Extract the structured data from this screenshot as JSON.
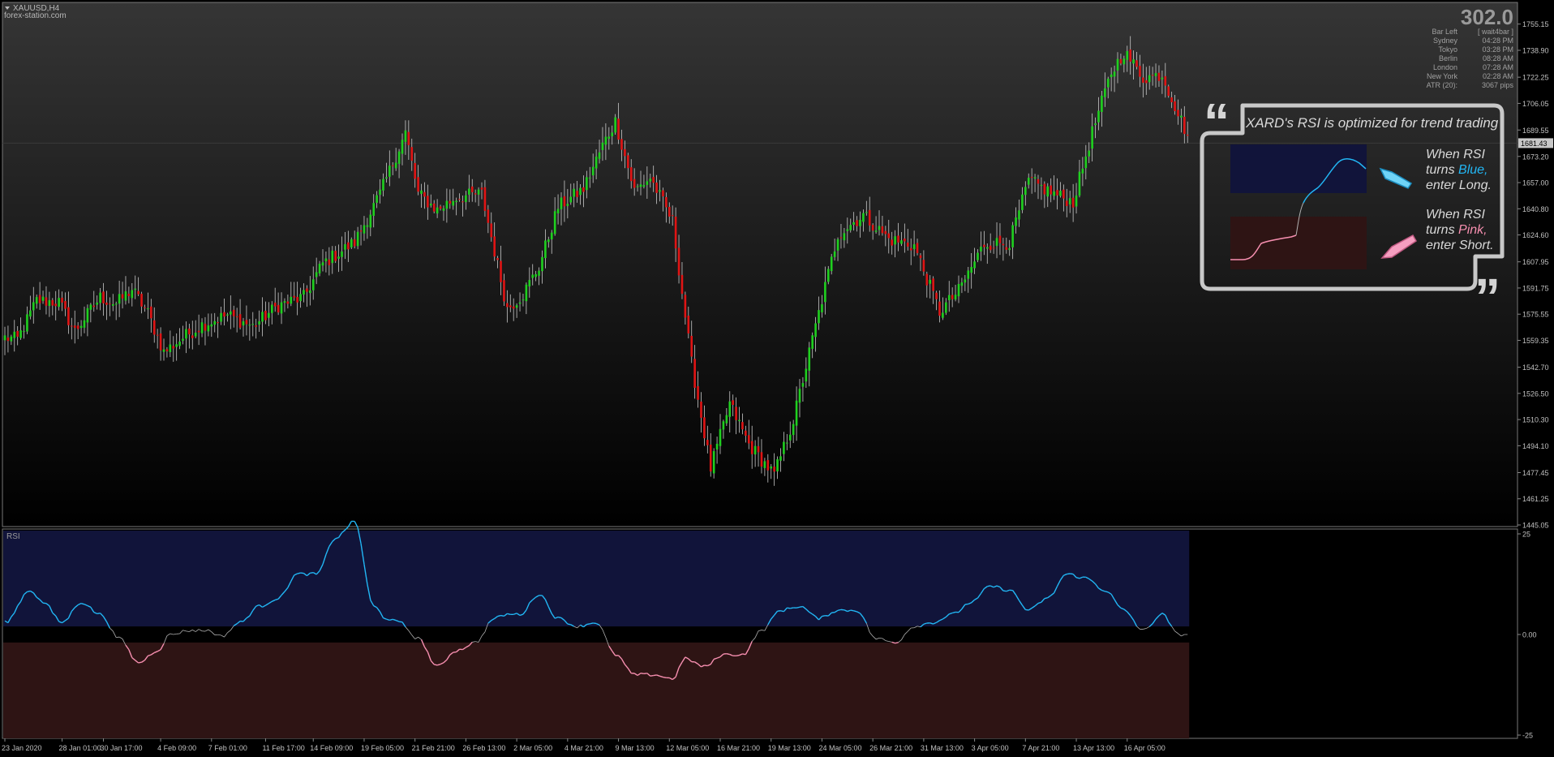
{
  "window": {
    "symbol_label": "XAUUSD,H4",
    "source_label": "forex-station.com"
  },
  "info_panel": {
    "big_value": "302.0",
    "rows": [
      {
        "label": "Bar Left",
        "value": "[ wait4bar ]"
      },
      {
        "label": "Sydney",
        "value": "04:28 PM"
      },
      {
        "label": "Tokyo",
        "value": "03:28 PM"
      },
      {
        "label": "Berlin",
        "value": "08:28 AM"
      },
      {
        "label": "London",
        "value": "07:28 AM"
      },
      {
        "label": "New York",
        "value": "02:28 AM"
      },
      {
        "label": "ATR (20):",
        "value": "3067 pips"
      }
    ]
  },
  "callout": {
    "title": "XARD's RSI is optimized for trend trading",
    "long_lines": [
      "When RSI",
      "turns ",
      "enter Long."
    ],
    "long_word": "Blue,",
    "short_lines": [
      "When RSI",
      "turns ",
      "enter Short."
    ],
    "short_word": "Pink,"
  },
  "colors": {
    "bull": "#1fd01f",
    "bear": "#e01414",
    "rsi_blue": "#22b7f5",
    "rsi_pink": "#f78fb0",
    "rsi_neutral": "#b0b0b0",
    "zone_blue": "#11143a",
    "zone_red": "#2e1414",
    "axis_text": "#c0c0c0"
  },
  "chart_data": [
    {
      "type": "candlestick",
      "symbol": "XAUUSD,H4",
      "ylim": [
        1445.05,
        1760.0
      ],
      "yticks": [
        1755.15,
        1738.9,
        1722.25,
        1706.05,
        1689.55,
        1673.2,
        1657.0,
        1640.8,
        1624.6,
        1607.95,
        1591.75,
        1575.55,
        1559.35,
        1542.7,
        1526.5,
        1510.3,
        1494.1,
        1477.45,
        1461.25,
        1445.05
      ],
      "current_price_label": "1681.43",
      "current_price": 1681.43,
      "anchors": [
        {
          "bar": 0,
          "close": 1561
        },
        {
          "bar": 4,
          "close": 1560
        },
        {
          "bar": 10,
          "close": 1584
        },
        {
          "bar": 17,
          "close": 1583
        },
        {
          "bar": 22,
          "close": 1565
        },
        {
          "bar": 30,
          "close": 1586
        },
        {
          "bar": 35,
          "close": 1582
        },
        {
          "bar": 40,
          "close": 1591
        },
        {
          "bar": 45,
          "close": 1576
        },
        {
          "bar": 50,
          "close": 1552
        },
        {
          "bar": 56,
          "close": 1561
        },
        {
          "bar": 62,
          "close": 1569
        },
        {
          "bar": 70,
          "close": 1575
        },
        {
          "bar": 78,
          "close": 1568
        },
        {
          "bar": 86,
          "close": 1581
        },
        {
          "bar": 94,
          "close": 1586
        },
        {
          "bar": 100,
          "close": 1607
        },
        {
          "bar": 110,
          "close": 1620
        },
        {
          "bar": 118,
          "close": 1650
        },
        {
          "bar": 126,
          "close": 1688
        },
        {
          "bar": 130,
          "close": 1650
        },
        {
          "bar": 136,
          "close": 1640
        },
        {
          "bar": 142,
          "close": 1648
        },
        {
          "bar": 150,
          "close": 1650
        },
        {
          "bar": 158,
          "close": 1579
        },
        {
          "bar": 163,
          "close": 1588
        },
        {
          "bar": 168,
          "close": 1605
        },
        {
          "bar": 174,
          "close": 1642
        },
        {
          "bar": 182,
          "close": 1653
        },
        {
          "bar": 188,
          "close": 1680
        },
        {
          "bar": 192,
          "close": 1695
        },
        {
          "bar": 198,
          "close": 1652
        },
        {
          "bar": 203,
          "close": 1660
        },
        {
          "bar": 210,
          "close": 1633
        },
        {
          "bar": 216,
          "close": 1545
        },
        {
          "bar": 222,
          "close": 1480
        },
        {
          "bar": 228,
          "close": 1520
        },
        {
          "bar": 234,
          "close": 1495
        },
        {
          "bar": 242,
          "close": 1476
        },
        {
          "bar": 248,
          "close": 1510
        },
        {
          "bar": 254,
          "close": 1560
        },
        {
          "bar": 262,
          "close": 1625
        },
        {
          "bar": 270,
          "close": 1637
        },
        {
          "bar": 278,
          "close": 1622
        },
        {
          "bar": 286,
          "close": 1618
        },
        {
          "bar": 294,
          "close": 1577
        },
        {
          "bar": 300,
          "close": 1590
        },
        {
          "bar": 308,
          "close": 1619
        },
        {
          "bar": 316,
          "close": 1620
        },
        {
          "bar": 322,
          "close": 1658
        },
        {
          "bar": 330,
          "close": 1650
        },
        {
          "bar": 336,
          "close": 1645
        },
        {
          "bar": 342,
          "close": 1688
        },
        {
          "bar": 348,
          "close": 1725
        },
        {
          "bar": 352,
          "close": 1738
        },
        {
          "bar": 358,
          "close": 1722
        },
        {
          "bar": 364,
          "close": 1724
        },
        {
          "bar": 369,
          "close": 1700
        },
        {
          "bar": 372,
          "close": 1686
        }
      ]
    },
    {
      "type": "line",
      "title": "RSI",
      "ylim": [
        -25,
        25
      ],
      "yticks": [
        25,
        0.0,
        -25
      ],
      "ytick_labels": [
        "25",
        "0.00",
        "-25"
      ],
      "neutral_band": [
        -2,
        2
      ],
      "x_bars": [
        0,
        8,
        12,
        18,
        24,
        30,
        36,
        42,
        48,
        52,
        58,
        64,
        68,
        74,
        80,
        86,
        92,
        98,
        104,
        110,
        116,
        120,
        124,
        130,
        136,
        142,
        148,
        154,
        158,
        162,
        168,
        174,
        180,
        186,
        192,
        198,
        204,
        210,
        214,
        220,
        226,
        232,
        238,
        244,
        250,
        256,
        262,
        268,
        274,
        280,
        286,
        292,
        298,
        304,
        310,
        316,
        322,
        328,
        334,
        340,
        346,
        352,
        358,
        364,
        369,
        372
      ],
      "values": [
        3,
        11,
        8,
        3,
        8,
        5,
        -1,
        -7,
        -4,
        0,
        1,
        1,
        -0.5,
        3,
        7,
        9,
        15,
        15,
        24,
        28,
        7,
        4,
        3,
        -1,
        -8,
        -4,
        -2,
        4,
        5,
        5,
        10,
        4,
        2,
        3,
        -5,
        -10,
        -10,
        -11,
        -6,
        -8,
        -5,
        -5,
        1,
        6,
        7,
        4,
        6,
        6,
        -1,
        -2,
        2,
        3,
        5,
        8,
        12,
        11,
        6,
        9,
        15,
        14,
        11,
        6,
        1,
        5,
        0,
        0
      ],
      "color_segments": "blue above 2, pink below -2, grey between"
    }
  ],
  "x_axis": {
    "labels": [
      {
        "bar": 0,
        "text": "23 Jan 2020"
      },
      {
        "bar": 18,
        "text": "28 Jan 01:00"
      },
      {
        "bar": 31,
        "text": "30 Jan 17:00"
      },
      {
        "bar": 49,
        "text": "4 Feb 09:00"
      },
      {
        "bar": 65,
        "text": "7 Feb 01:00"
      },
      {
        "bar": 82,
        "text": "11 Feb 17:00"
      },
      {
        "bar": 97,
        "text": "14 Feb 09:00"
      },
      {
        "bar": 113,
        "text": "19 Feb 05:00"
      },
      {
        "bar": 129,
        "text": "21 Feb 21:00"
      },
      {
        "bar": 145,
        "text": "26 Feb 13:00"
      },
      {
        "bar": 161,
        "text": "2 Mar 05:00"
      },
      {
        "bar": 177,
        "text": "4 Mar 21:00"
      },
      {
        "bar": 193,
        "text": "9 Mar 13:00"
      },
      {
        "bar": 209,
        "text": "12 Mar 05:00"
      },
      {
        "bar": 225,
        "text": "16 Mar 21:00"
      },
      {
        "bar": 241,
        "text": "19 Mar 13:00"
      },
      {
        "bar": 257,
        "text": "24 Mar 05:00"
      },
      {
        "bar": 273,
        "text": "26 Mar 21:00"
      },
      {
        "bar": 289,
        "text": "31 Mar 13:00"
      },
      {
        "bar": 305,
        "text": "3 Apr 05:00"
      },
      {
        "bar": 321,
        "text": "7 Apr 21:00"
      },
      {
        "bar": 337,
        "text": "13 Apr 13:00"
      },
      {
        "bar": 353,
        "text": "16 Apr 05:00"
      }
    ]
  }
}
